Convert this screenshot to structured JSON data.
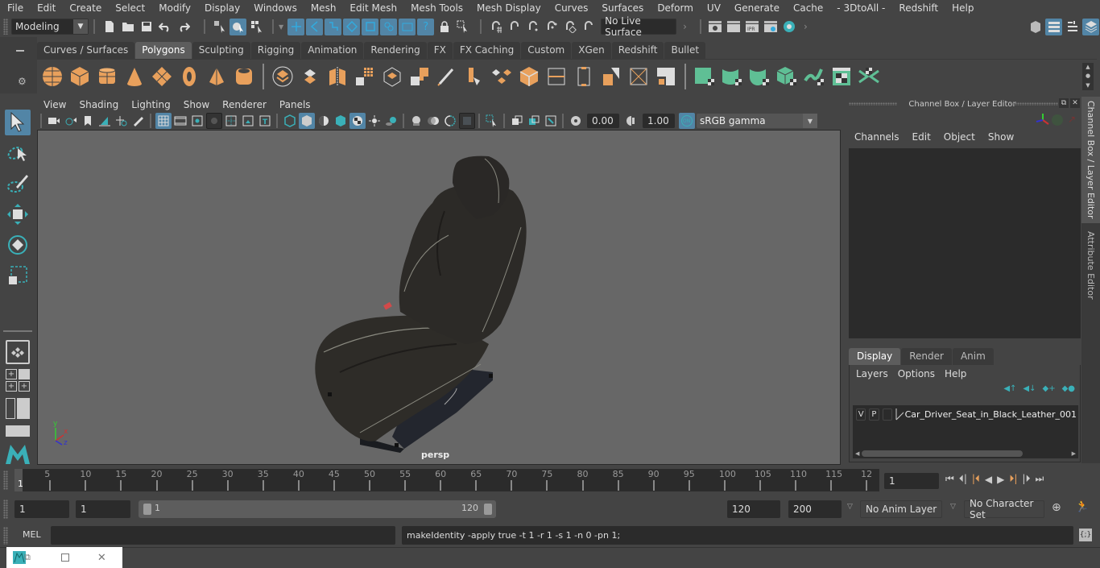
{
  "menubar": [
    "File",
    "Edit",
    "Create",
    "Select",
    "Modify",
    "Display",
    "Windows",
    "Mesh",
    "Edit Mesh",
    "Mesh Tools",
    "Mesh Display",
    "Curves",
    "Surfaces",
    "Deform",
    "UV",
    "Generate",
    "Cache",
    "- 3DtoAll -",
    "Redshift",
    "Help"
  ],
  "status_line": {
    "mode": "Modeling",
    "live_surface": "No Live Surface"
  },
  "shelf": {
    "tabs": [
      "Curves / Surfaces",
      "Polygons",
      "Sculpting",
      "Rigging",
      "Animation",
      "Rendering",
      "FX",
      "FX Caching",
      "Custom",
      "XGen",
      "Redshift",
      "Bullet"
    ],
    "active_tab": "Polygons"
  },
  "viewport": {
    "menu": [
      "View",
      "Shading",
      "Lighting",
      "Show",
      "Renderer",
      "Panels"
    ],
    "exposure": "0.00",
    "gamma": "1.00",
    "color_space": "sRGB gamma",
    "color_mgmt_badge": "ON",
    "camera_label": "persp",
    "axis": {
      "x": "x",
      "y": "y",
      "z": "z"
    }
  },
  "channel_box": {
    "title": "Channel Box / Layer Editor",
    "menu": [
      "Channels",
      "Edit",
      "Object",
      "Show"
    ],
    "layer_tabs": [
      "Display",
      "Render",
      "Anim"
    ],
    "active_layer_tab": "Display",
    "layer_menu": [
      "Layers",
      "Options",
      "Help"
    ],
    "layers": [
      {
        "v": "V",
        "p": "P",
        "name": "Car_Driver_Seat_in_Black_Leather_001"
      }
    ]
  },
  "side_tabs": [
    "Channel Box / Layer Editor",
    "Attribute Editor"
  ],
  "timeline": {
    "ticks": [
      "5",
      "10",
      "15",
      "20",
      "25",
      "30",
      "35",
      "40",
      "45",
      "50",
      "55",
      "60",
      "65",
      "70",
      "75",
      "80",
      "85",
      "90",
      "95",
      "100",
      "105",
      "110",
      "115",
      "12"
    ],
    "current_frame_marker": "1",
    "current_frame": "1"
  },
  "range": {
    "start": "1",
    "anim_start": "1",
    "slider_start": "1",
    "slider_end": "120",
    "anim_end": "120",
    "end": "200",
    "anim_layer": "No Anim Layer",
    "character_set": "No Character Set"
  },
  "command_line": {
    "lang": "MEL",
    "input": "",
    "result": "makeIdentity -apply true -t 1 -r 1 -s 1 -n 0 -pn 1;"
  },
  "colors": {
    "accent": "#5285a6",
    "shelf_orange": "#e8a05c",
    "shelf_green": "#5fbf95",
    "teal": "#3ab0b8"
  }
}
